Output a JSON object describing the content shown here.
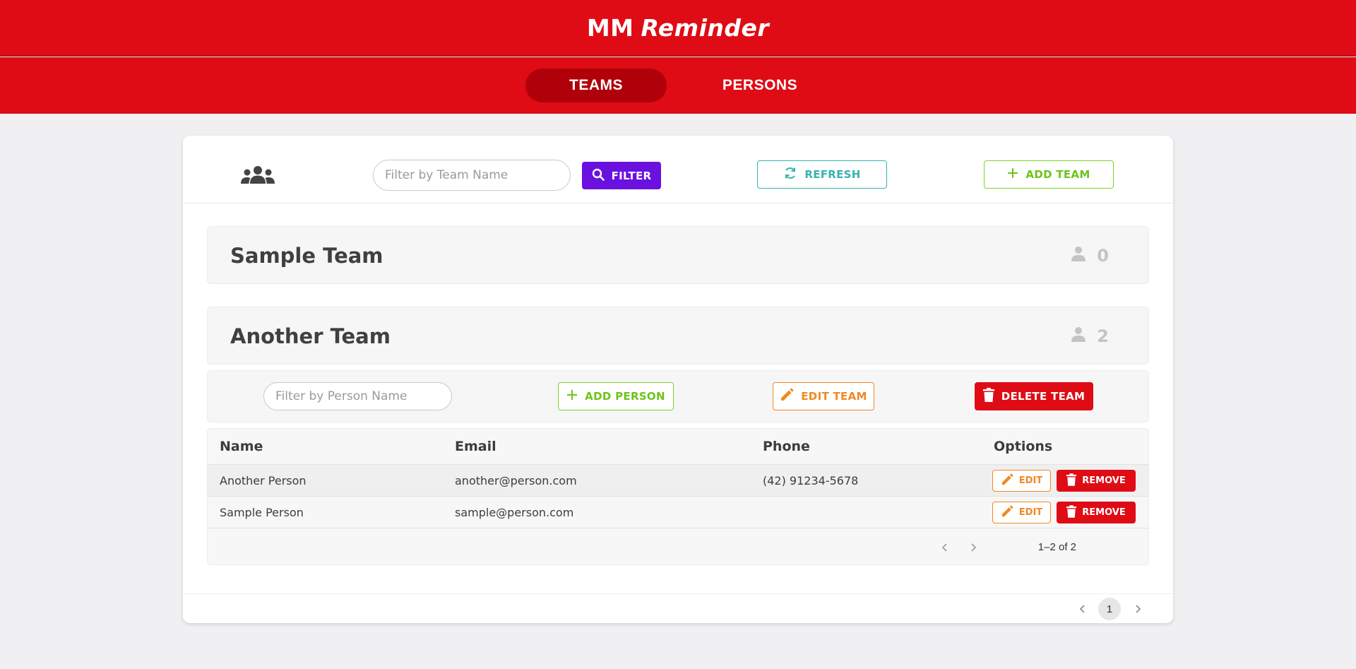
{
  "app": {
    "title_part1": "MM",
    "title_part2": "Reminder"
  },
  "nav": {
    "tabs": [
      {
        "label": "TEAMS",
        "active": true
      },
      {
        "label": "PERSONS",
        "active": false
      }
    ]
  },
  "toolbar": {
    "team_filter_placeholder": "Filter by Team Name",
    "filter_label": "FILTER",
    "refresh_label": "REFRESH",
    "add_team_label": "ADD TEAM"
  },
  "teams": [
    {
      "name": "Sample Team",
      "member_count": "0"
    },
    {
      "name": "Another Team",
      "member_count": "2"
    }
  ],
  "team_actions": {
    "person_filter_placeholder": "Filter by Person Name",
    "add_person_label": "ADD PERSON",
    "edit_team_label": "EDIT TEAM",
    "delete_team_label": "DELETE TEAM"
  },
  "persons_table": {
    "columns": [
      "Name",
      "Email",
      "Phone",
      "Options"
    ],
    "rows": [
      {
        "name": "Another Person",
        "email": "another@person.com",
        "phone": "(42) 91234-5678"
      },
      {
        "name": "Sample Person",
        "email": "sample@person.com",
        "phone": ""
      }
    ],
    "row_actions": {
      "edit_label": "EDIT",
      "remove_label": "REMOVE"
    },
    "range_text": "1–2 of 2"
  },
  "pagination": {
    "current_page": "1"
  },
  "colors": {
    "brand_red": "#df0c15",
    "active_tab": "#b00009",
    "filter_purple": "#6a11e0",
    "refresh_teal": "#35b3ad",
    "add_green": "#7ed321",
    "edit_orange": "#f08a24"
  },
  "icons": [
    "group-icon",
    "search-icon",
    "refresh-icon",
    "plus-icon",
    "person-icon",
    "pencil-icon",
    "trash-icon",
    "chevron-left-icon",
    "chevron-right-icon"
  ]
}
